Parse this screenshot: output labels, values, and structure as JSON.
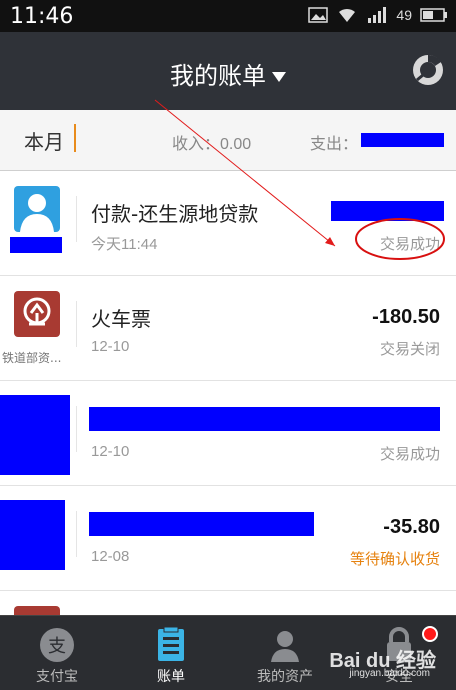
{
  "status_bar": {
    "time": "11:46",
    "battery": "49"
  },
  "header": {
    "title": "我的账单"
  },
  "summary": {
    "period": "本月",
    "income": "收入：0.00",
    "expense_label": "支出："
  },
  "transactions": [
    {
      "name": "付款-还生源地贷款",
      "date": "今天11:44",
      "amount": "",
      "status": "交易成功",
      "merchant": ""
    },
    {
      "name": "火车票",
      "date": "12-10",
      "amount": "-180.50",
      "status": "交易关闭",
      "merchant": "铁道部资..."
    },
    {
      "name": "",
      "date": "12-10",
      "amount": "",
      "status": "交易成功",
      "merchant": ""
    },
    {
      "name": "",
      "date": "12-08",
      "amount": "-35.80",
      "status": "等待确认收货",
      "merchant": ""
    }
  ],
  "tabs": [
    {
      "label": "支付宝"
    },
    {
      "label": "账单"
    },
    {
      "label": "我的资产"
    },
    {
      "label": "安全"
    }
  ],
  "watermark": {
    "brand": "Bai du 经验",
    "url": "jingyan.baidu.com"
  },
  "colors": {
    "mask": "#0000ff",
    "accent": "#e88b1c",
    "pending": "#e6820f",
    "tab_active": "#3bb4e6"
  }
}
